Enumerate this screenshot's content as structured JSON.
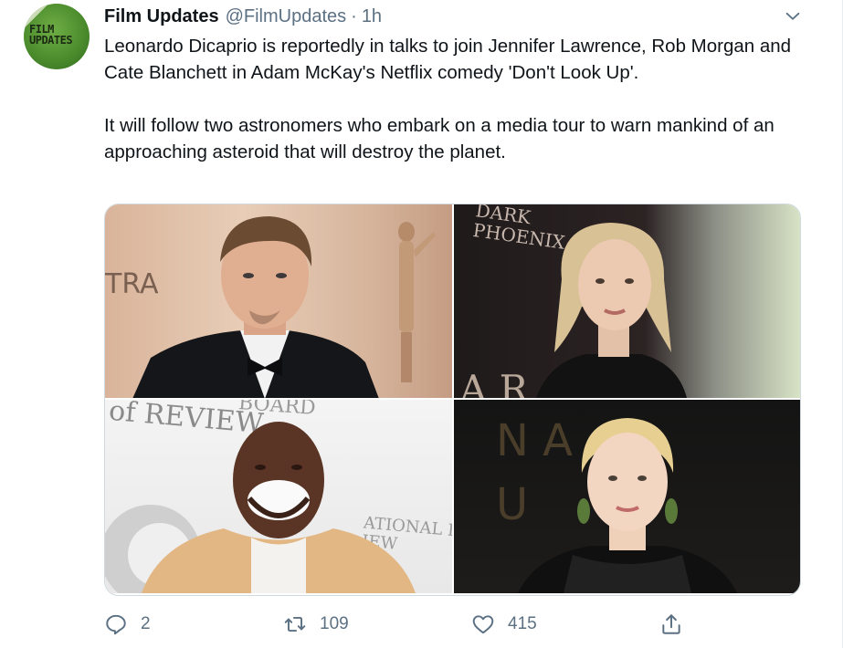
{
  "tweet": {
    "author_name": "Film Updates",
    "author_handle": "@FilmUpdates",
    "separator": "·",
    "time": "1h",
    "avatar_text": "FILM UPDATES",
    "text": "Leonardo Dicaprio is reportedly in talks to join Jennifer Lawrence, Rob Morgan and Cate Blanchett in Adam McKay's Netflix comedy 'Don't Look Up'.\n\nIt will follow two astronomers who embark on a media tour to warn mankind of an approaching asteroid that will destroy the planet."
  },
  "media": {
    "photo1_backdrop_text": "TRA",
    "photo2_backdrop_text": "DARK\nPHOENIX",
    "photo2_bottom_text": "A R",
    "photo3_backdrop_text": "of REVIEW",
    "photo3_backdrop_text2": "BOARD",
    "photo3_backdrop_text3": "ATIONAL B\nIEW",
    "photo4_backdrop_text": "N A  O\nU      M"
  },
  "actions": {
    "reply_count": "2",
    "retweet_count": "109",
    "like_count": "415"
  },
  "icons": {
    "caret": "chevron-down-icon",
    "reply": "reply-icon",
    "retweet": "retweet-icon",
    "like": "heart-icon",
    "share": "share-icon"
  },
  "colors": {
    "text_primary": "#0f1419",
    "text_secondary": "#5b7083",
    "border": "#cfd9de",
    "avatar_green": "#4a8a2c"
  }
}
